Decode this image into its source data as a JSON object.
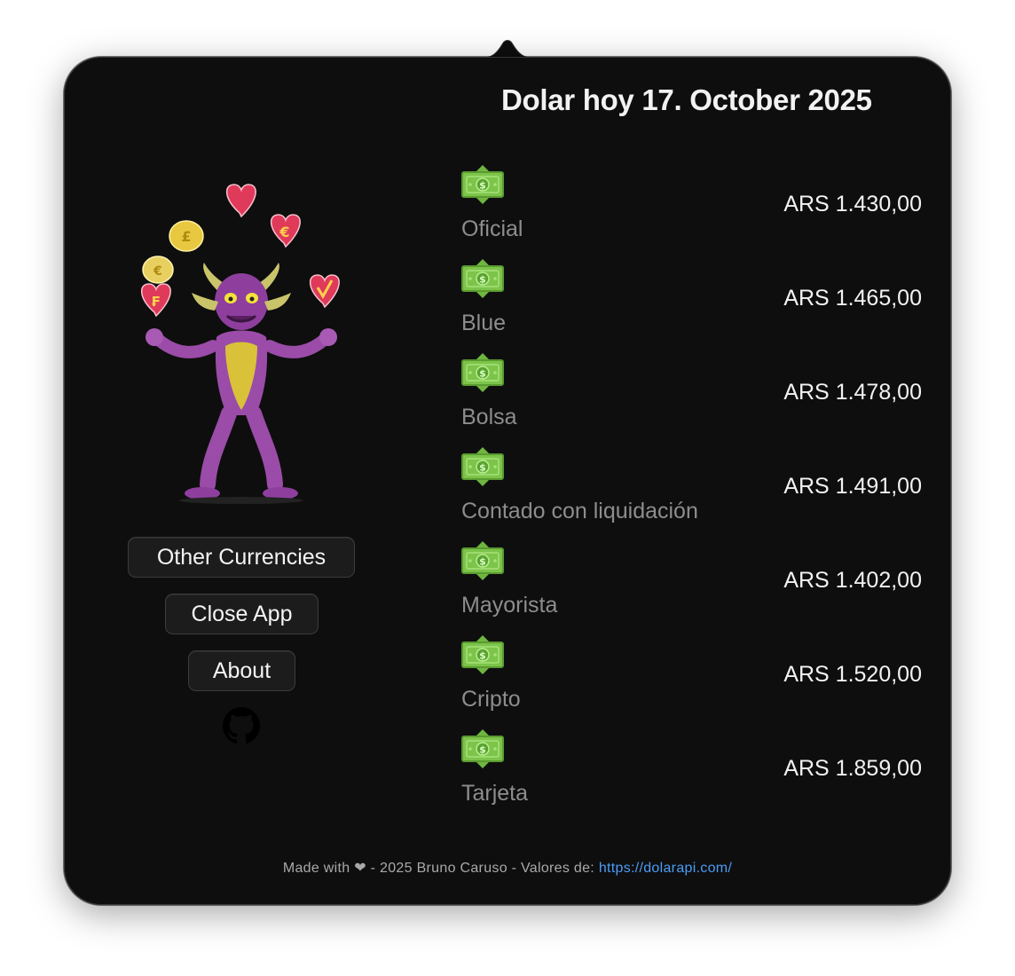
{
  "header": {
    "title": "Dolar hoy 17. October 2025"
  },
  "buttons": {
    "other_currencies": "Other Currencies",
    "close_app": "Close App",
    "about": "About"
  },
  "rates": [
    {
      "name": "Oficial",
      "value": "ARS 1.430,00"
    },
    {
      "name": "Blue",
      "value": "ARS 1.465,00"
    },
    {
      "name": "Bolsa",
      "value": "ARS 1.478,00"
    },
    {
      "name": "Contado con liquidación",
      "value": "ARS 1.491,00"
    },
    {
      "name": "Mayorista",
      "value": "ARS 1.402,00"
    },
    {
      "name": "Cripto",
      "value": "ARS 1.520,00"
    },
    {
      "name": "Tarjeta",
      "value": "ARS 1.859,00"
    }
  ],
  "footer": {
    "text_before": "Made with",
    "heart": "❤",
    "text_after": "- 2025 Bruno Caruso - Valores de:",
    "link": "https://dolarapi.com/"
  },
  "icons": {
    "rate_icon": "money-bill-icon",
    "github": "github-icon",
    "mascot": "juggling-devil-mascot"
  },
  "colors": {
    "background": "#0e0e0e",
    "title": "#f2f2f2",
    "rate_name": "#8d8d8d",
    "link": "#4a9cf5",
    "money_green": "#7cc44a"
  }
}
